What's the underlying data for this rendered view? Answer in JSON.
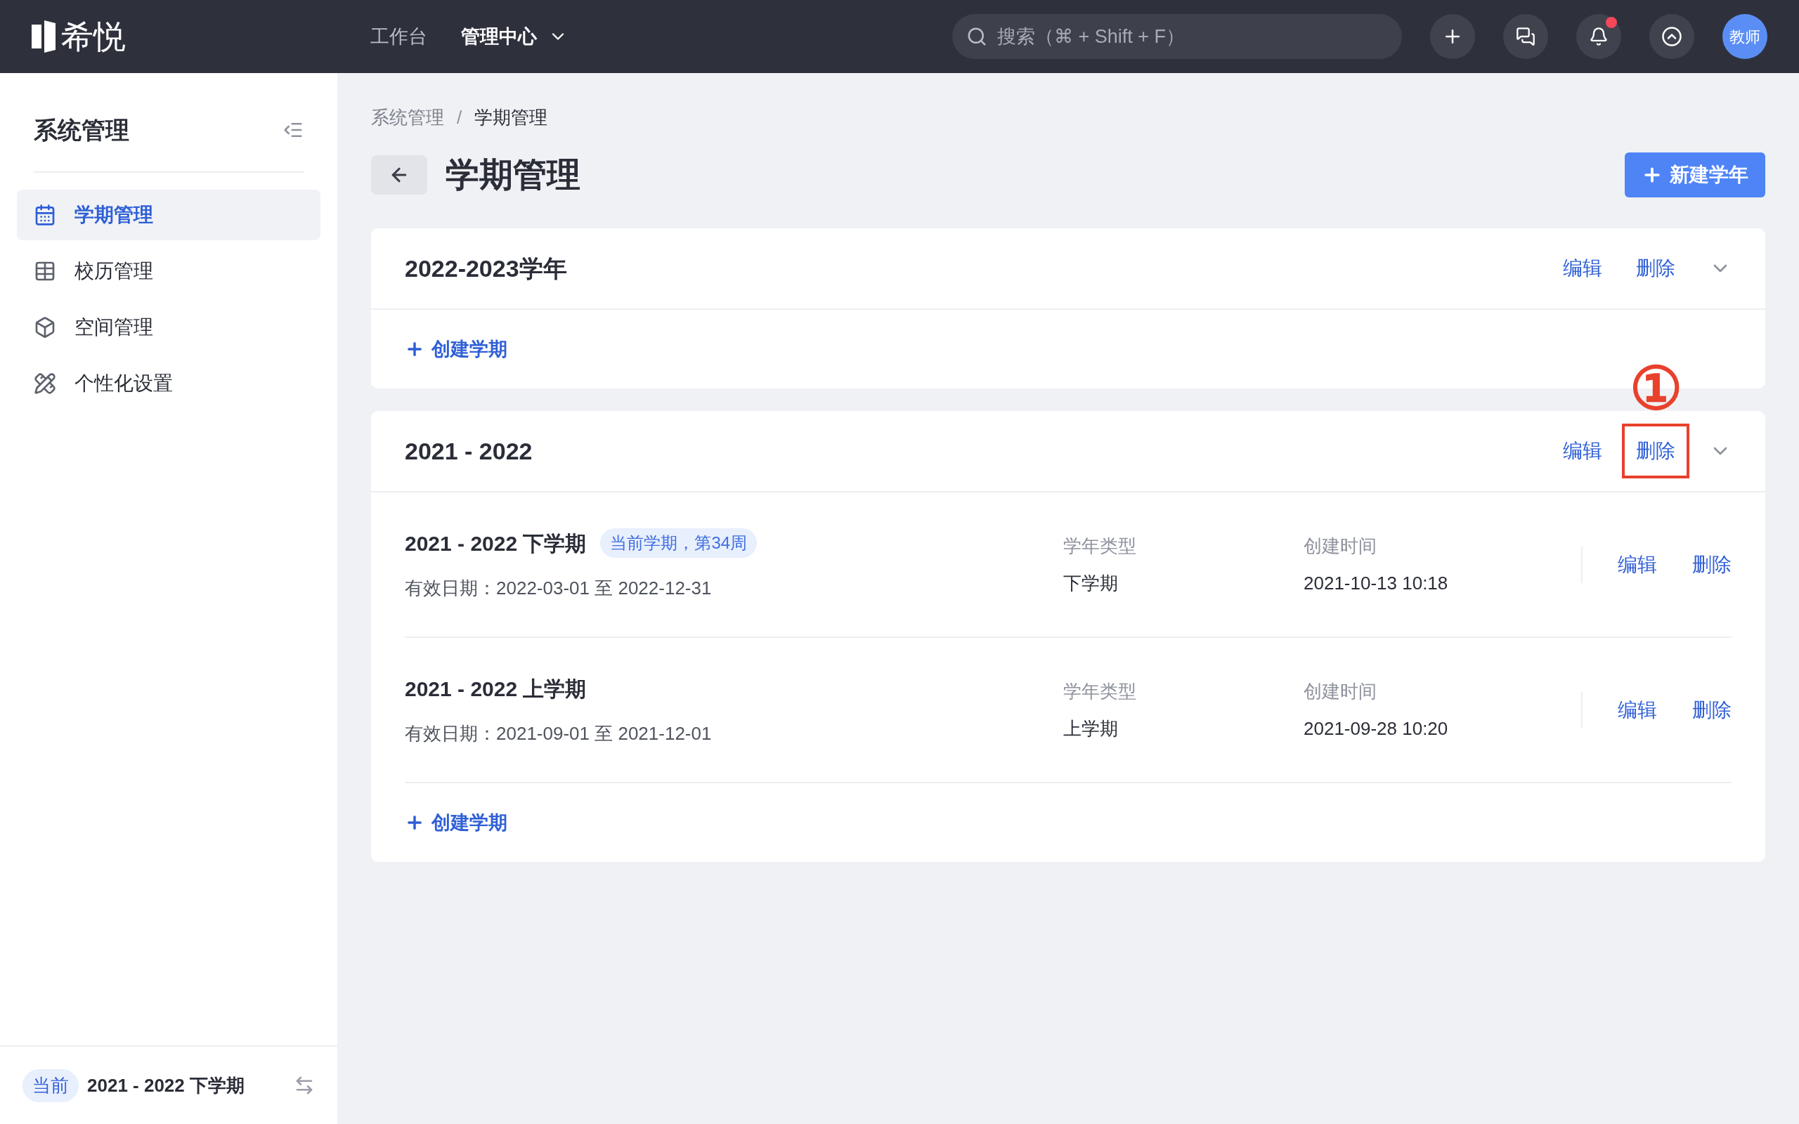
{
  "topbar": {
    "logo_text": "希悦",
    "nav": [
      {
        "label": "工作台",
        "selected": false,
        "dropdown": false
      },
      {
        "label": "管理中心",
        "selected": true,
        "dropdown": true
      }
    ],
    "search": {
      "placeholder": "搜索（⌘ + Shift + F）"
    },
    "has_unread": true,
    "avatar": "教师"
  },
  "sidebar": {
    "title": "系统管理",
    "items": [
      {
        "label": "学期管理",
        "selected": true
      },
      {
        "label": "校历管理",
        "selected": false
      },
      {
        "label": "空间管理",
        "selected": false
      },
      {
        "label": "个性化设置",
        "selected": false
      }
    ],
    "footer": {
      "tag": "当前",
      "term": "2021 - 2022 下学期"
    }
  },
  "breadcrumb": [
    "系统管理",
    "学期管理"
  ],
  "breadcrumb_separator": "/",
  "page_title": "学期管理",
  "new_button": "新建学年",
  "years": [
    {
      "title": "2022-2023学年",
      "actions": [
        {
          "label": "编辑",
          "highlighted": false
        },
        {
          "label": "删除",
          "highlighted": false
        }
      ],
      "create_label": "创建学期"
    },
    {
      "title": "2021 - 2022",
      "actions": [
        {
          "label": "编辑",
          "highlighted": false
        },
        {
          "label": "删除",
          "highlighted": true
        }
      ],
      "annotation": "①",
      "terms": [
        {
          "name": "2021 - 2022 下学期",
          "badge": "当前学期，第34周",
          "validity": "有效日期：2022-03-01 至 2022-12-31",
          "type_label": "学年类型",
          "type_value": "下学期",
          "created_label": "创建时间",
          "created_value": "2021-10-13 10:18",
          "actions": [
            "编辑",
            "删除"
          ]
        },
        {
          "name": "2021 - 2022 上学期",
          "validity": "有效日期：2021-09-01 至 2021-12-01",
          "type_label": "学年类型",
          "type_value": "上学期",
          "created_label": "创建时间",
          "created_value": "2021-09-28 10:20",
          "actions": [
            "编辑",
            "删除"
          ]
        }
      ],
      "create_label": "创建学期"
    }
  ]
}
